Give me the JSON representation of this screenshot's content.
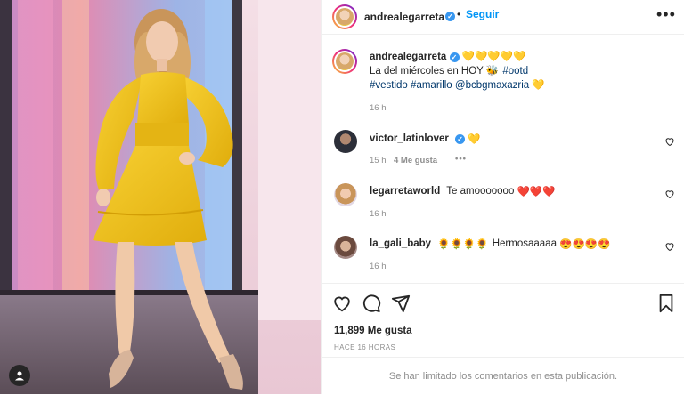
{
  "post": {
    "username": "andrealegarreta",
    "follow_label": "Seguir",
    "separator": "•",
    "more_label": "•••"
  },
  "caption": {
    "username": "andrealegarreta",
    "line1": "La del miércoles en HOY",
    "tag1": "#ootd",
    "tag2": "#vestido",
    "tag3": "#amarillo",
    "mention": "@bcbgmaxazria",
    "time": "16 h"
  },
  "comments": [
    {
      "username": "victor_latinlover",
      "text": "",
      "time": "15 h",
      "likes": "4 Me gusta",
      "more": "•••"
    },
    {
      "username": "legarretaworld",
      "text": "Te amooooooo",
      "time": "16 h"
    },
    {
      "username": "la_gali_baby",
      "text": "Hermosaaaaa",
      "time": "16 h"
    }
  ],
  "footer": {
    "likes_count": "11,899 Me gusta",
    "time_ago": "HACE 16 HORAS",
    "comments_limited": "Se han limitado los comentarios en esta publicación."
  },
  "colors": {
    "dress": "#f2c21a",
    "link": "#0095f6",
    "verified": "#3897f0",
    "muted": "#8e8e8e"
  },
  "icons": [
    "heart-icon",
    "comment-icon",
    "share-icon",
    "bookmark-icon",
    "verified-icon",
    "more-icon",
    "user-tag-icon"
  ]
}
